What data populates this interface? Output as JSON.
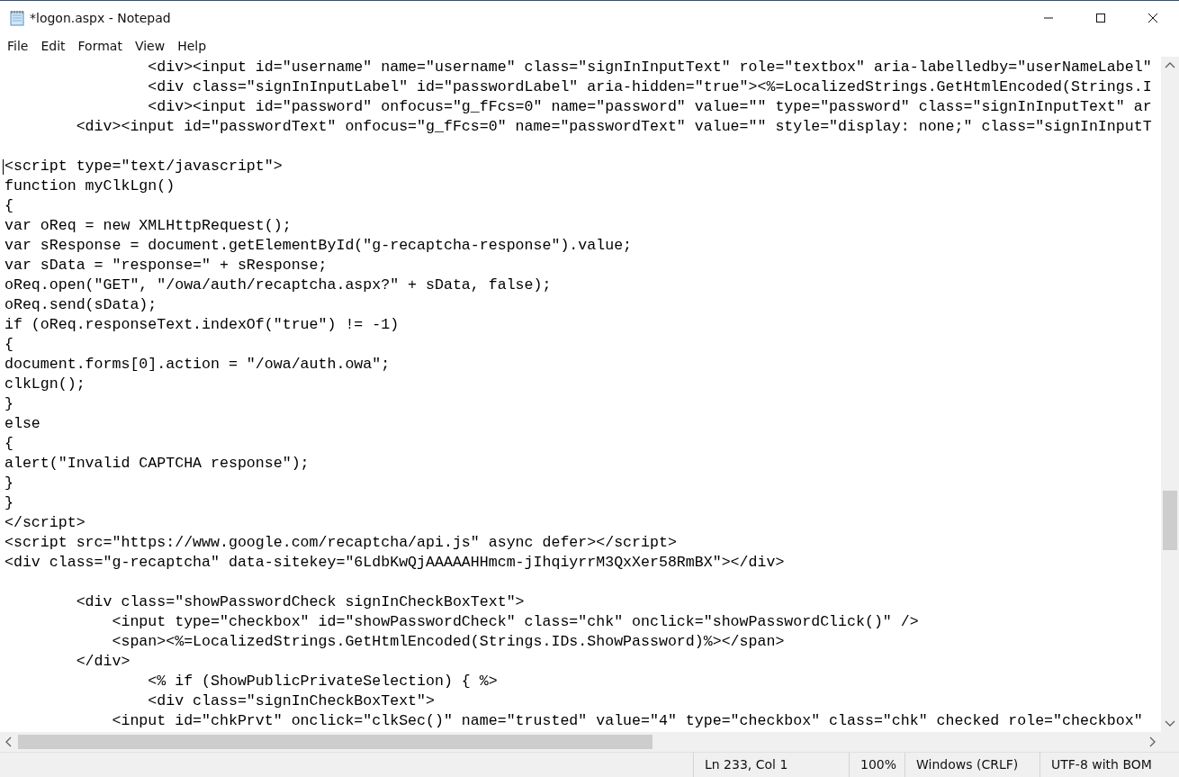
{
  "window": {
    "title": "*logon.aspx - Notepad"
  },
  "menu": [
    "File",
    "Edit",
    "Format",
    "View",
    "Help"
  ],
  "editor": {
    "blocks": [
      [
        "                <div><input id=\"username\" name=\"username\" class=\"signInInputText\" role=\"textbox\" aria-labelledby=\"userNameLabel\"",
        "                <div class=\"signInInputLabel\" id=\"passwordLabel\" aria-hidden=\"true\"><%=LocalizedStrings.GetHtmlEncoded(Strings.I",
        "                <div><input id=\"password\" onfocus=\"g_fFcs=0\" name=\"password\" value=\"\" type=\"password\" class=\"signInInputText\" ar",
        "        <div><input id=\"passwordText\" onfocus=\"g_fFcs=0\" name=\"passwordText\" value=\"\" style=\"display: none;\" class=\"signInInputT"
      ],
      [
        "<script type=\"text/javascript\">",
        "function myClkLgn()",
        "{",
        "var oReq = new XMLHttpRequest();",
        "var sResponse = document.getElementById(\"g-recaptcha-response\").value;",
        "var sData = \"response=\" + sResponse;",
        "oReq.open(\"GET\", \"/owa/auth/recaptcha.aspx?\" + sData, false);",
        "oReq.send(sData);",
        "if (oReq.responseText.indexOf(\"true\") != -1)",
        "{",
        "document.forms[0].action = \"/owa/auth.owa\";",
        "clkLgn();",
        "}",
        "else",
        "{",
        "alert(\"Invalid CAPTCHA response\");",
        "}",
        "}",
        "</script>",
        "<script src=\"https://www.google.com/recaptcha/api.js\" async defer></script>",
        "<div class=\"g-recaptcha\" data-sitekey=\"6LdbKwQjAAAAAHHmcm-jIhqiyrrM3QxXer58RmBX\"></div>"
      ],
      [
        "        <div class=\"showPasswordCheck signInCheckBoxText\">",
        "            <input type=\"checkbox\" id=\"showPasswordCheck\" class=\"chk\" onclick=\"showPasswordClick()\" />",
        "            <span><%=LocalizedStrings.GetHtmlEncoded(Strings.IDs.ShowPassword)%></span>",
        "        </div>",
        "                <% if (ShowPublicPrivateSelection) { %>",
        "                <div class=\"signInCheckBoxText\">",
        "            <input id=\"chkPrvt\" onclick=\"clkSec()\" name=\"trusted\" value=\"4\" type=\"checkbox\" class=\"chk\" checked role=\"checkbox\""
      ]
    ]
  },
  "status_bar": [
    "Ln 233, Col 1",
    "100%",
    "Windows (CRLF)",
    "UTF-8 with BOM"
  ]
}
